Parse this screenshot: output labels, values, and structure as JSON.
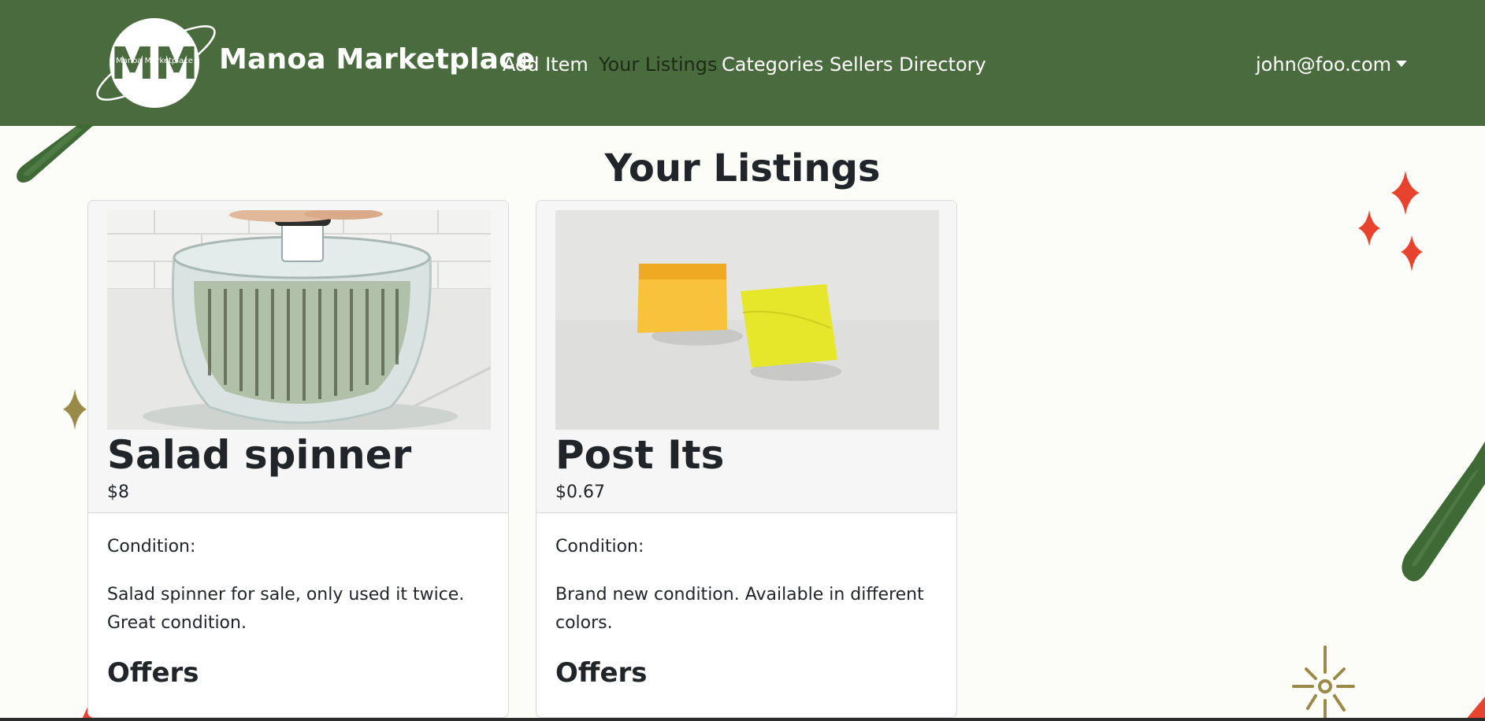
{
  "navbar": {
    "brand": "Manoa Marketplace",
    "logo_text": "Manoa Marketplace",
    "logo_letters": "MM",
    "links": [
      {
        "label": "Add Item",
        "active": false
      },
      {
        "label": "Your Listings",
        "active": true
      },
      {
        "label": "Categories",
        "active": false
      },
      {
        "label": "Sellers Directory",
        "active": false
      }
    ],
    "user": "john@foo.com"
  },
  "page": {
    "title": "Your Listings"
  },
  "listings": [
    {
      "title": "Salad spinner",
      "price": "$8",
      "condition_label": "Condition:",
      "description": "Salad spinner for sale, only used it twice. Great condition.",
      "offers_heading": "Offers",
      "image": "salad-spinner-photo"
    },
    {
      "title": "Post Its",
      "price": "$0.67",
      "condition_label": "Condition:",
      "description": "Brand new condition. Available in different colors.",
      "offers_heading": "Offers",
      "image": "post-its-photo"
    }
  ],
  "colors": {
    "navbar": "#4a6b3e",
    "background": "#fcfcf8",
    "accent_red": "#e8432e",
    "accent_olive": "#9a8a47",
    "brush_green": "#3f6a36"
  }
}
